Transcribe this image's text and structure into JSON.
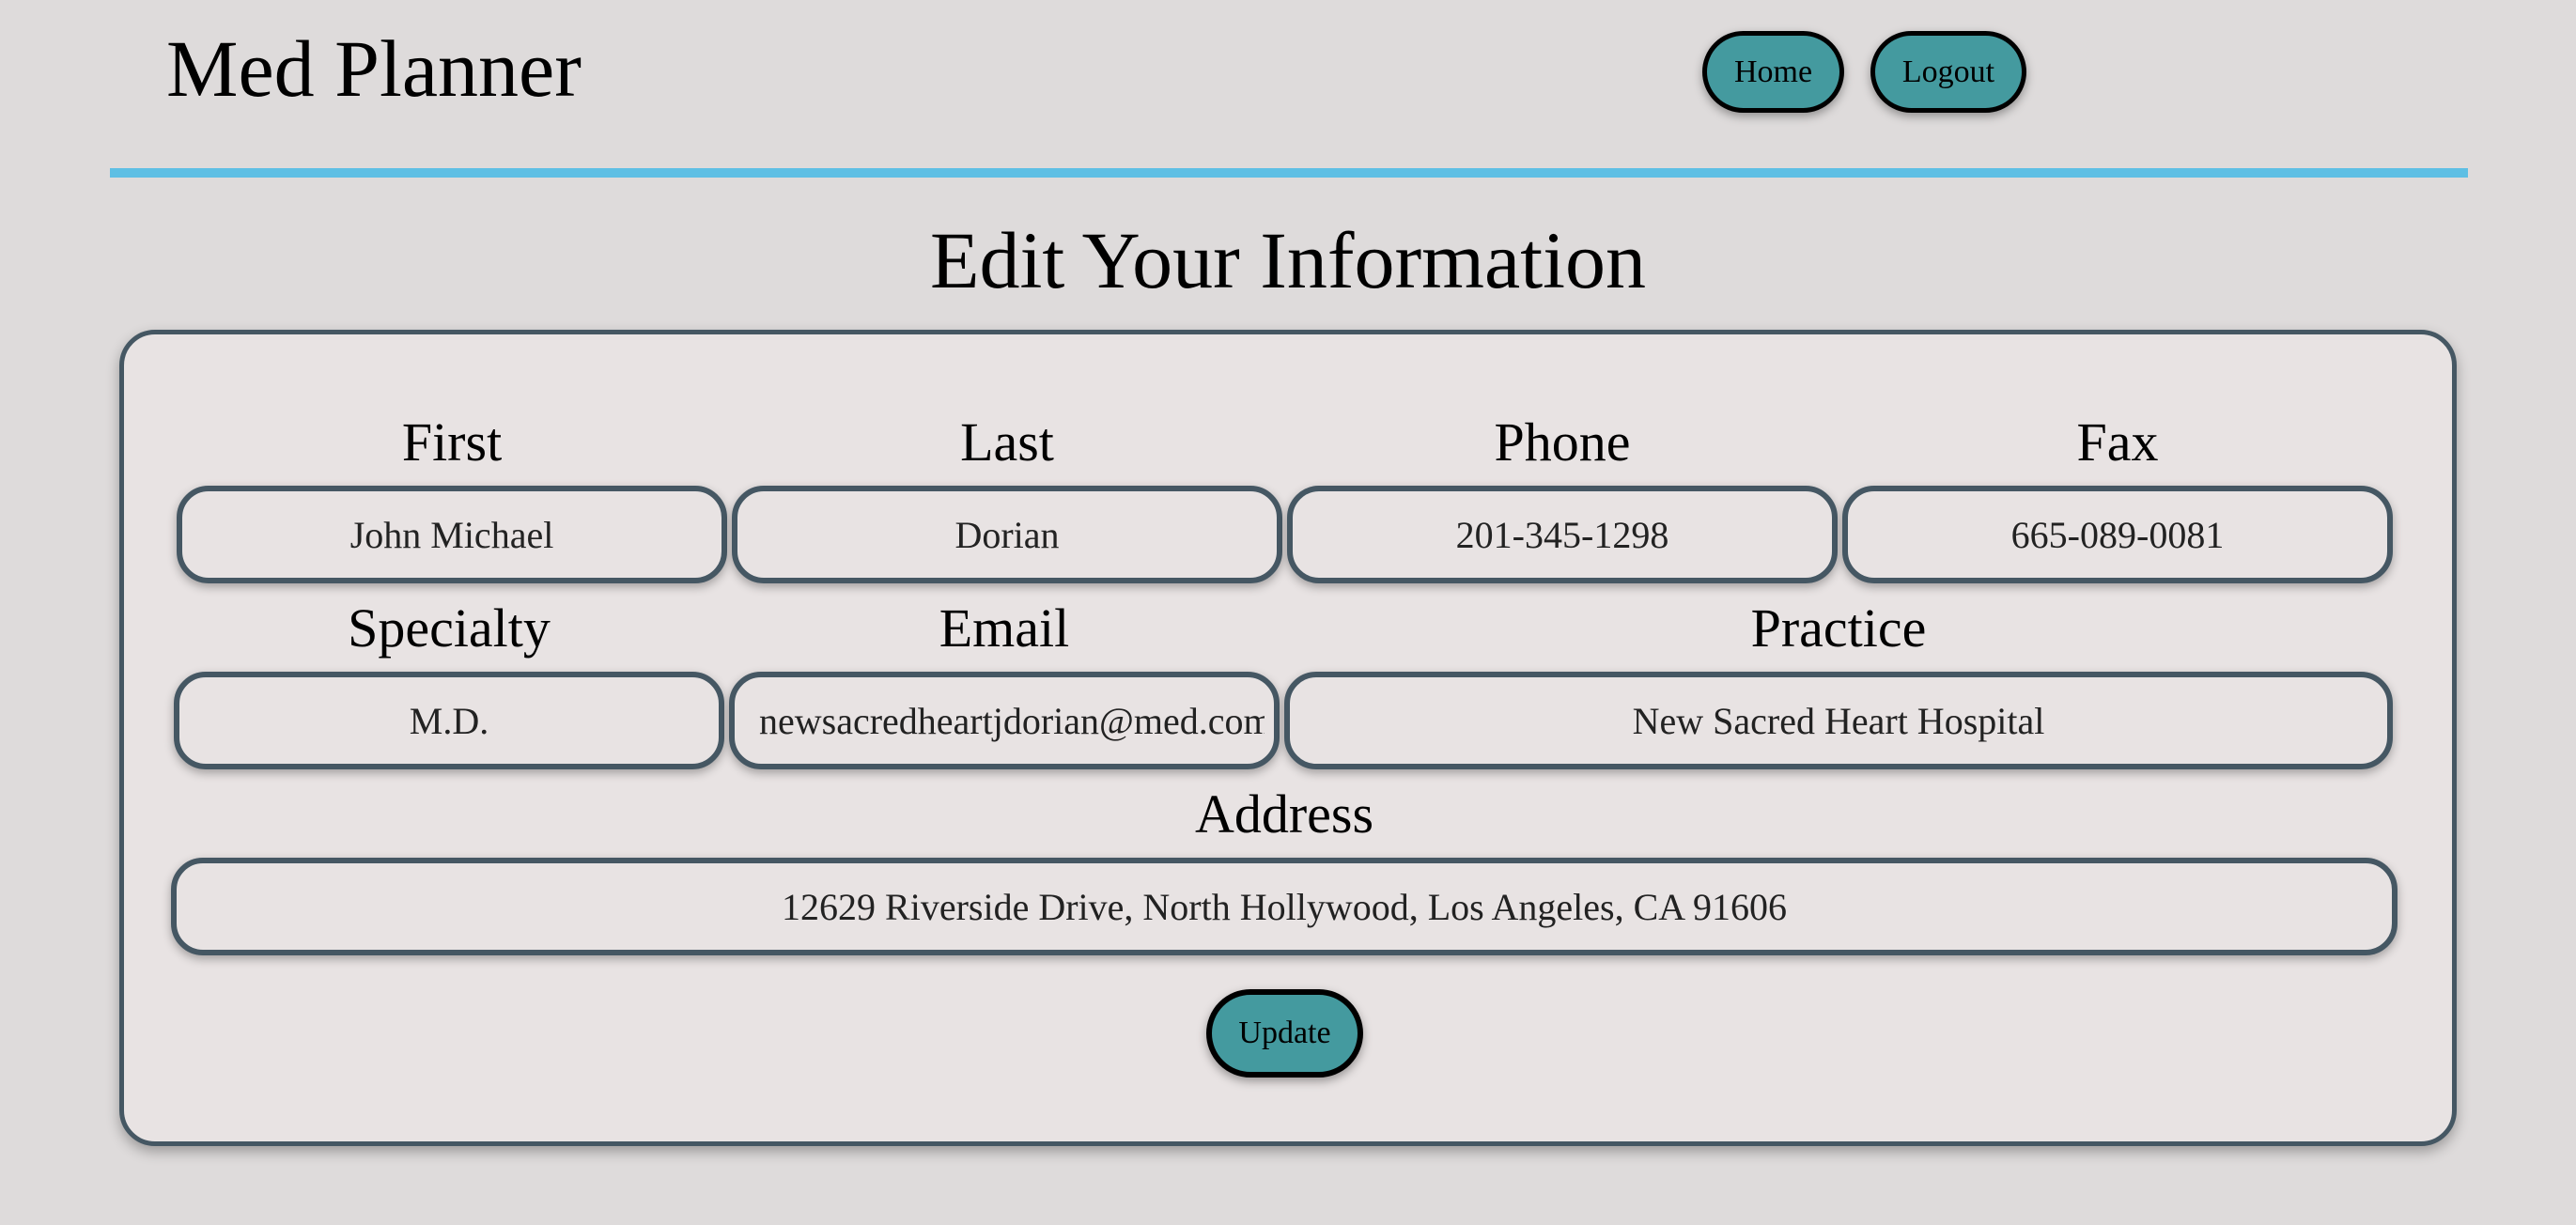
{
  "header": {
    "site_title": "Med Planner",
    "nav": {
      "home_label": "Home",
      "logout_label": "Logout"
    }
  },
  "page": {
    "title": "Edit Your Information"
  },
  "form": {
    "first": {
      "label": "First",
      "value": "John Michael"
    },
    "last": {
      "label": "Last",
      "value": "Dorian"
    },
    "phone": {
      "label": "Phone",
      "value": "201-345-1298"
    },
    "fax": {
      "label": "Fax",
      "value": "665-089-0081"
    },
    "specialty": {
      "label": "Specialty",
      "value": "M.D."
    },
    "email": {
      "label": "Email",
      "value": "newsacredheartjdorian@med.com"
    },
    "practice": {
      "label": "Practice",
      "value": "New Sacred Heart Hospital"
    },
    "address": {
      "label": "Address",
      "value": "12629 Riverside Drive, North Hollywood, Los Angeles, CA 91606"
    },
    "update_label": "Update"
  },
  "colors": {
    "background": "#dedbdb",
    "accent_rule": "#5ebfe4",
    "button": "#449a9f",
    "card_border": "#455763"
  }
}
